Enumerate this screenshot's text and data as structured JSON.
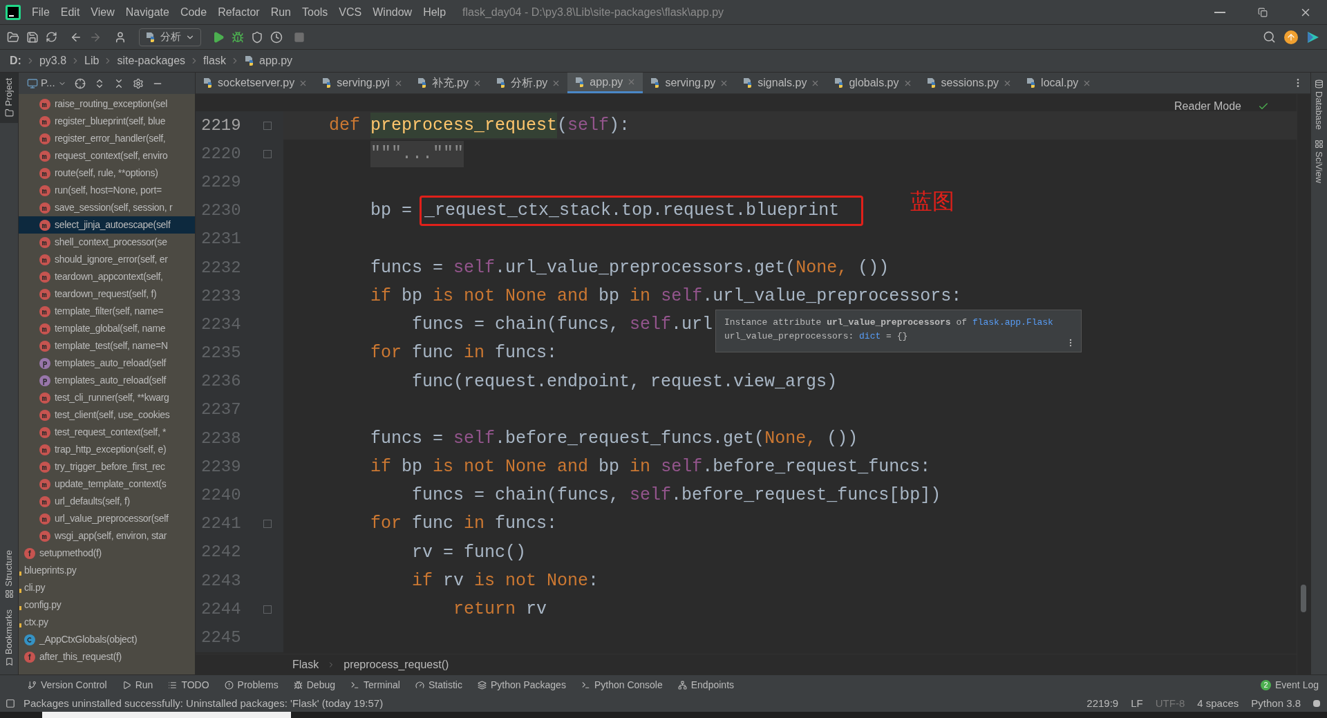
{
  "window": {
    "title": "flask_day04 - D:\\py3.8\\Lib\\site-packages\\flask\\app.py"
  },
  "menu": [
    "File",
    "Edit",
    "View",
    "Navigate",
    "Code",
    "Refactor",
    "Run",
    "Tools",
    "VCS",
    "Window",
    "Help"
  ],
  "toolbar": {
    "run_config": "分析"
  },
  "breadcrumb": [
    "D:",
    "py3.8",
    "Lib",
    "site-packages",
    "flask",
    "app.py"
  ],
  "project_panel": {
    "title": "P..."
  },
  "tabs": [
    {
      "label": "socketserver.py",
      "selected": false
    },
    {
      "label": "serving.pyi",
      "selected": false
    },
    {
      "label": "补充.py",
      "selected": false
    },
    {
      "label": "分析.py",
      "selected": false
    },
    {
      "label": "app.py",
      "selected": true
    },
    {
      "label": "serving.py",
      "selected": false
    },
    {
      "label": "signals.py",
      "selected": false
    },
    {
      "label": "globals.py",
      "selected": false
    },
    {
      "label": "sessions.py",
      "selected": false
    },
    {
      "label": "local.py",
      "selected": false
    }
  ],
  "tree": [
    {
      "children": [
        {
          "children": [
            {
              "kind": "method",
              "label": "raise_routing_exception(sel",
              "selected": false
            },
            {
              "kind": "method",
              "label": "register_blueprint(self, blue",
              "selected": false
            },
            {
              "kind": "method",
              "label": "register_error_handler(self,",
              "selected": false
            },
            {
              "kind": "method",
              "label": "request_context(self, enviro",
              "selected": false
            },
            {
              "kind": "method",
              "label": "route(self, rule, **options)",
              "selected": false
            },
            {
              "kind": "method",
              "label": "run(self, host=None, port=",
              "selected": false
            },
            {
              "kind": "method",
              "label": "save_session(self, session, r",
              "selected": false
            },
            {
              "kind": "method",
              "label": "select_jinja_autoescape(self",
              "selected": true
            },
            {
              "kind": "method",
              "label": "shell_context_processor(se",
              "selected": false
            },
            {
              "kind": "method",
              "label": "should_ignore_error(self, er",
              "selected": false
            },
            {
              "kind": "method",
              "label": "teardown_appcontext(self,",
              "selected": false
            },
            {
              "kind": "method",
              "label": "teardown_request(self, f)",
              "selected": false
            },
            {
              "kind": "method",
              "label": "template_filter(self, name=",
              "selected": false
            },
            {
              "kind": "method",
              "label": "template_global(self, name",
              "selected": false
            },
            {
              "kind": "method",
              "label": "template_test(self, name=N",
              "selected": false
            },
            {
              "kind": "property",
              "label": "templates_auto_reload(self",
              "selected": false
            },
            {
              "kind": "property",
              "label": "templates_auto_reload(self",
              "selected": false
            },
            {
              "kind": "method",
              "label": "test_cli_runner(self, **kwarg",
              "selected": false
            },
            {
              "kind": "method",
              "label": "test_client(self, use_cookies",
              "selected": false
            },
            {
              "kind": "method",
              "label": "test_request_context(self, *",
              "selected": false
            },
            {
              "kind": "method",
              "label": "trap_http_exception(self, e)",
              "selected": false
            },
            {
              "kind": "method",
              "label": "try_trigger_before_first_rec",
              "selected": false
            },
            {
              "kind": "method",
              "label": "update_template_context(s",
              "selected": false
            },
            {
              "kind": "method",
              "label": "url_defaults(self, f)",
              "selected": false
            },
            {
              "kind": "method",
              "label": "url_value_preprocessor(self",
              "selected": false
            },
            {
              "kind": "method",
              "label": "wsgi_app(self, environ, star",
              "selected": false
            }
          ]
        },
        {
          "kind": "function",
          "label": "setupmethod(f)",
          "selected": false
        }
      ]
    },
    {
      "kind": "file",
      "label": "blueprints.py",
      "selected": false
    },
    {
      "kind": "file",
      "label": "cli.py",
      "selected": false
    },
    {
      "kind": "file",
      "label": "config.py",
      "selected": false
    },
    {
      "kind": "file",
      "label": "ctx.py",
      "selected": false,
      "children": [
        {
          "kind": "class",
          "label": "_AppCtxGlobals(object)",
          "selected": false
        },
        {
          "kind": "function",
          "label": "after_this_request(f)",
          "selected": false
        }
      ]
    }
  ],
  "side_stripes": {
    "left": [
      "Project",
      "Structure",
      "Bookmarks"
    ],
    "right": [
      "Database",
      "SciView"
    ]
  },
  "editor": {
    "reader_mode": "Reader Mode",
    "lines": [
      {
        "number": "2219",
        "current": true,
        "fold": true,
        "tokens": [
          {
            "kind": "kw",
            "text": "    def "
          },
          {
            "kind": "fn",
            "text": "preprocess_request"
          },
          {
            "kind": "plain",
            "text": "("
          },
          {
            "kind": "self",
            "text": "self"
          },
          {
            "kind": "plain",
            "text": "):"
          }
        ]
      },
      {
        "number": "2220",
        "current": false,
        "fold": true,
        "tokens": [
          {
            "kind": "folded",
            "text": "        \"\"\"...\"\"\""
          }
        ]
      },
      {
        "number": "2229",
        "current": false,
        "fold": false
      },
      {
        "number": "2230",
        "current": false,
        "fold": false,
        "annotation": "蓝图",
        "tokens": [
          {
            "kind": "plain",
            "text": "        bp = "
          },
          {
            "kind": "boxed",
            "text": "_request_ctx_stack.top.request.blueprint"
          }
        ]
      },
      {
        "number": "2231",
        "current": false,
        "fold": false
      },
      {
        "number": "2232",
        "current": false,
        "fold": false,
        "tokens": [
          {
            "kind": "plain",
            "text": "        funcs = "
          },
          {
            "kind": "self",
            "text": "self"
          },
          {
            "kind": "plain",
            "text": ".url_value_preprocessors.get("
          },
          {
            "kind": "kw",
            "text": "None, "
          },
          {
            "kind": "plain",
            "text": "())"
          }
        ]
      },
      {
        "number": "2233",
        "current": false,
        "fold": false,
        "tokens": [
          {
            "kind": "kw",
            "text": "        if "
          },
          {
            "kind": "plain",
            "text": "bp "
          },
          {
            "kind": "kw",
            "text": "is not None and "
          },
          {
            "kind": "plain",
            "text": "bp "
          },
          {
            "kind": "kw",
            "text": "in "
          },
          {
            "kind": "self",
            "text": "self"
          },
          {
            "kind": "plain",
            "text": ".url_value_preprocessors:"
          }
        ]
      },
      {
        "number": "2234",
        "current": false,
        "fold": false,
        "tokens": [
          {
            "kind": "plain",
            "text": "            funcs = chain(funcs, "
          },
          {
            "kind": "self",
            "text": "self"
          },
          {
            "kind": "plain",
            "text": ".url"
          }
        ]
      },
      {
        "number": "2235",
        "current": false,
        "fold": false,
        "tokens": [
          {
            "kind": "kw",
            "text": "        for "
          },
          {
            "kind": "plain",
            "text": "func "
          },
          {
            "kind": "kw",
            "text": "in "
          },
          {
            "kind": "plain",
            "text": "funcs:"
          }
        ]
      },
      {
        "number": "2236",
        "current": false,
        "fold": false,
        "tokens": [
          {
            "kind": "plain",
            "text": "            func(request.endpoint, request.view_args)"
          }
        ]
      },
      {
        "number": "2237",
        "current": false,
        "fold": false
      },
      {
        "number": "2238",
        "current": false,
        "fold": false,
        "tokens": [
          {
            "kind": "plain",
            "text": "        funcs = "
          },
          {
            "kind": "self",
            "text": "self"
          },
          {
            "kind": "plain",
            "text": ".before_request_funcs.get("
          },
          {
            "kind": "kw",
            "text": "None, "
          },
          {
            "kind": "plain",
            "text": "())"
          }
        ]
      },
      {
        "number": "2239",
        "current": false,
        "fold": false,
        "tokens": [
          {
            "kind": "kw",
            "text": "        if "
          },
          {
            "kind": "plain",
            "text": "bp "
          },
          {
            "kind": "kw",
            "text": "is not None and "
          },
          {
            "kind": "plain",
            "text": "bp "
          },
          {
            "kind": "kw",
            "text": "in "
          },
          {
            "kind": "self",
            "text": "self"
          },
          {
            "kind": "plain",
            "text": ".before_request_funcs:"
          }
        ]
      },
      {
        "number": "2240",
        "current": false,
        "fold": false,
        "tokens": [
          {
            "kind": "plain",
            "text": "            funcs = chain(funcs, "
          },
          {
            "kind": "self",
            "text": "self"
          },
          {
            "kind": "plain",
            "text": ".before_request_funcs[bp])"
          }
        ]
      },
      {
        "number": "2241",
        "current": false,
        "fold": true,
        "tokens": [
          {
            "kind": "kw",
            "text": "        for "
          },
          {
            "kind": "plain",
            "text": "func "
          },
          {
            "kind": "kw",
            "text": "in "
          },
          {
            "kind": "plain",
            "text": "funcs:"
          }
        ]
      },
      {
        "number": "2242",
        "current": false,
        "fold": false,
        "tokens": [
          {
            "kind": "plain",
            "text": "            rv = func()"
          }
        ]
      },
      {
        "number": "2243",
        "current": false,
        "fold": false,
        "tokens": [
          {
            "kind": "kw",
            "text": "            if "
          },
          {
            "kind": "plain",
            "text": "rv "
          },
          {
            "kind": "kw",
            "text": "is not None"
          },
          {
            "kind": "plain",
            "text": ":"
          }
        ]
      },
      {
        "number": "2244",
        "current": false,
        "fold": true,
        "tokens": [
          {
            "kind": "kw",
            "text": "                return "
          },
          {
            "kind": "plain",
            "text": "rv"
          }
        ]
      },
      {
        "number": "2245",
        "current": false,
        "fold": false
      }
    ],
    "tooltip": {
      "line1": "Instance attribute **url_value_preprocessors** of ",
      "link": "flask.app.Flask",
      "line2_name": "url_value_preprocessors: ",
      "line2_type": "dict",
      "line2_rest": " = {}"
    },
    "breadcrumb": [
      "Flask",
      "preprocess_request()"
    ]
  },
  "tool_tabs": [
    "Version Control",
    "Run",
    "TODO",
    "Problems",
    "Debug",
    "Terminal",
    "Statistic",
    "Python Packages",
    "Python Console",
    "Endpoints"
  ],
  "event_log": {
    "label": "Event Log",
    "count": "2"
  },
  "status_bar": {
    "message": "Packages uninstalled successfully: Uninstalled packages: 'Flask' (today 19:57)",
    "position": "2219:9",
    "line_sep": "LF",
    "encoding": "UTF-8",
    "indent": "4 spaces",
    "interpreter": "Python 3.8"
  }
}
